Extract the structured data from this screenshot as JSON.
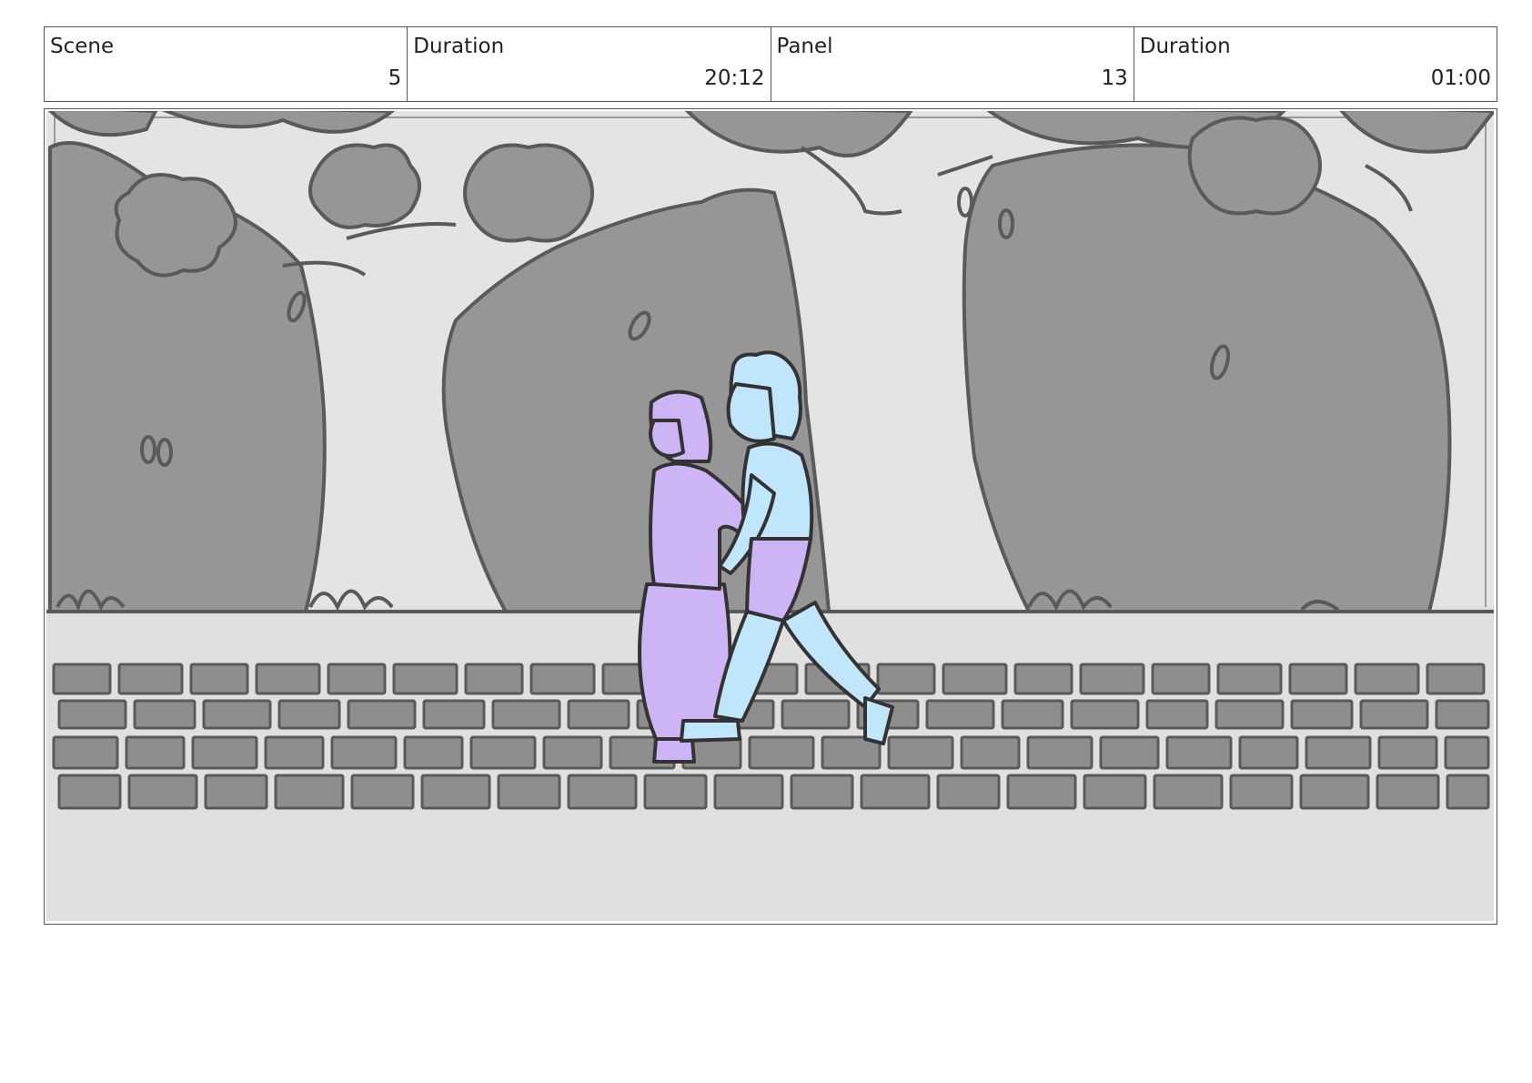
{
  "header": {
    "cells": [
      {
        "label": "Scene",
        "value": "5"
      },
      {
        "label": "Duration",
        "value": "20:12"
      },
      {
        "label": "Panel",
        "value": "13"
      },
      {
        "label": "Duration",
        "value": "01:00"
      }
    ]
  },
  "panel": {
    "colors": {
      "sky": "#e4e4e4",
      "trees": "#969696",
      "outline": "#5a5a5a",
      "ground": "#e0e0e0",
      "pavers": "#8e8e8e",
      "girl": "#cdb4f5",
      "boy": "#bfe6fb",
      "ink": "#333333"
    }
  }
}
